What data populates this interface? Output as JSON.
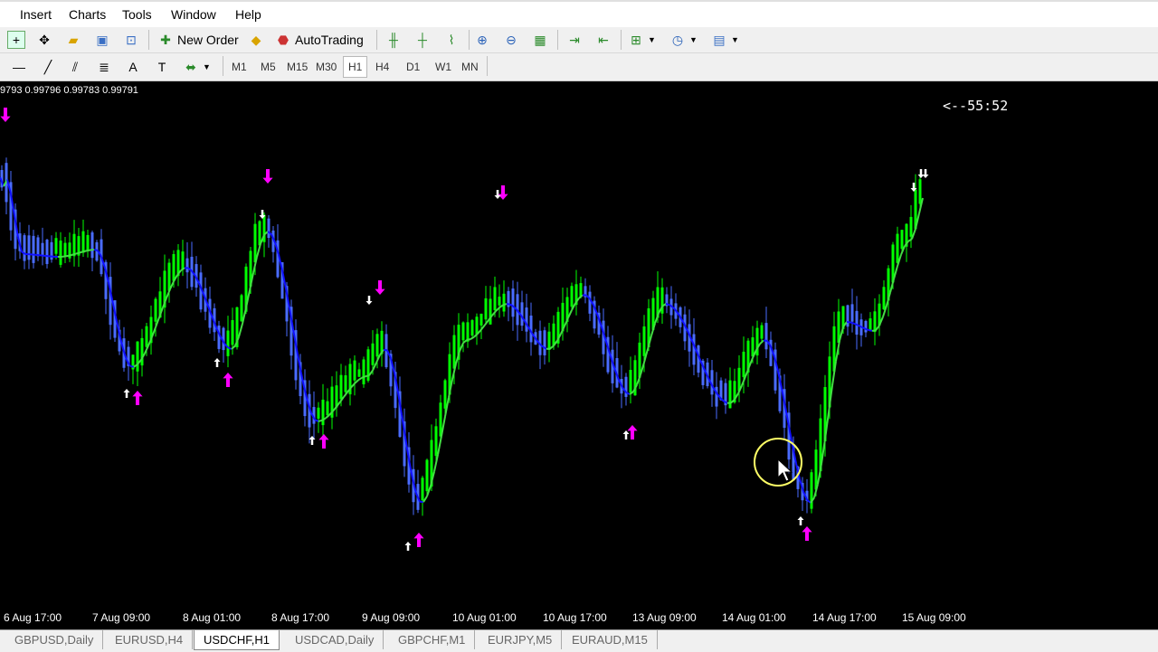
{
  "menu": [
    "Insert",
    "Charts",
    "Tools",
    "Window",
    "Help"
  ],
  "toolbar": {
    "new_order": "New Order",
    "autotrading": "AutoTrading"
  },
  "timeframes": [
    "M1",
    "M5",
    "M15",
    "M30",
    "H1",
    "H4",
    "D1",
    "W1",
    "MN"
  ],
  "active_timeframe": "H1",
  "chart": {
    "ohlc": "9793 0.99796 0.99783 0.99791",
    "timer": "<--55:52",
    "x_labels": [
      "6 Aug 17:00",
      "7 Aug 09:00",
      "8 Aug 01:00",
      "8 Aug 17:00",
      "9 Aug 09:00",
      "10 Aug 01:00",
      "10 Aug 17:00",
      "13 Aug 09:00",
      "14 Aug 01:00",
      "14 Aug 17:00",
      "15 Aug 09:00"
    ],
    "colors": {
      "background": "#000000",
      "bull": "#00ff00",
      "bear": "#4a6cff",
      "ma_up": "#44dd44",
      "ma_down": "#1010ff",
      "signal_arrow": "#ff00ff",
      "small_arrow": "#ffffff",
      "cursor_highlight": "#ffff66"
    }
  },
  "tabs": [
    "GBPUSD,Daily",
    "EURUSD,H4",
    "USDCHF,H1",
    "USDCAD,Daily",
    "GBPCHF,M1",
    "EURJPY,M5",
    "EURAUD,M15"
  ],
  "active_tab": "USDCHF,H1"
}
